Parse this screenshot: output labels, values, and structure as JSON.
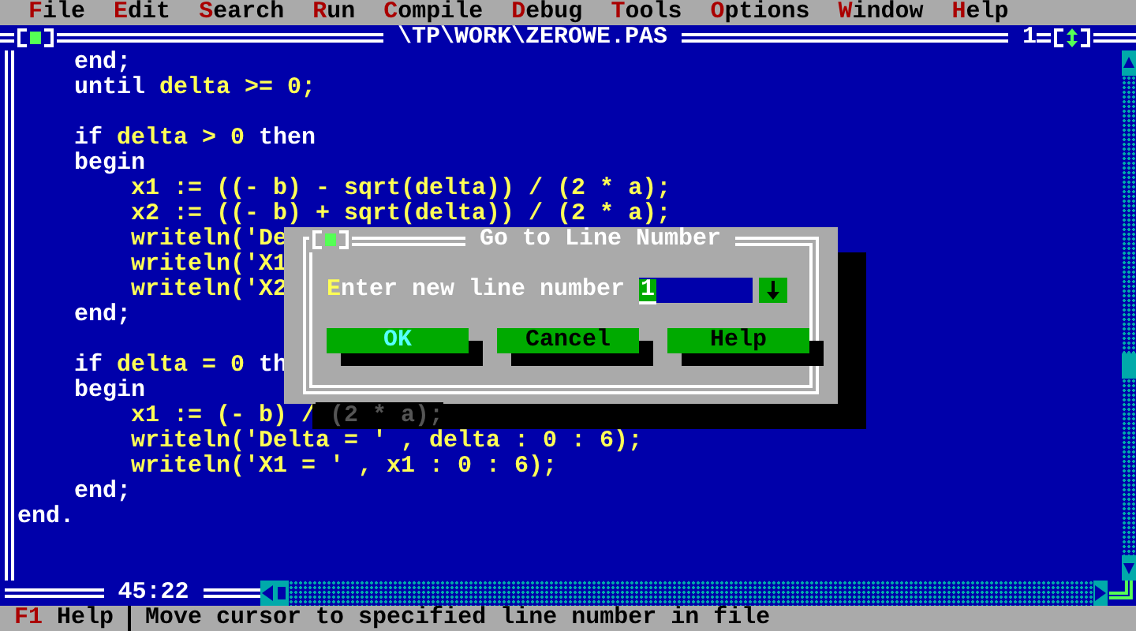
{
  "menu": [
    {
      "label": "File"
    },
    {
      "label": "Edit"
    },
    {
      "label": "Search"
    },
    {
      "label": "Run"
    },
    {
      "label": "Compile"
    },
    {
      "label": "Debug"
    },
    {
      "label": "Tools"
    },
    {
      "label": "Options"
    },
    {
      "label": "Window"
    },
    {
      "label": "Help"
    }
  ],
  "editor": {
    "title": "\\TP\\WORK\\ZEROWE.PAS",
    "window_number": "1",
    "cursor_position": "45:22",
    "lines": [
      {
        "kind": "code",
        "tokens": [
          {
            "kind": "keyword",
            "text": "    end;"
          }
        ]
      },
      {
        "kind": "code",
        "tokens": [
          {
            "kind": "keyword",
            "text": "    until"
          },
          {
            "kind": "text",
            "text": " delta >= 0;"
          }
        ]
      },
      {
        "kind": "blank"
      },
      {
        "kind": "code",
        "tokens": [
          {
            "kind": "keyword",
            "text": "    if"
          },
          {
            "kind": "text",
            "text": " delta > 0 "
          },
          {
            "kind": "keyword",
            "text": "then"
          }
        ]
      },
      {
        "kind": "code",
        "tokens": [
          {
            "kind": "keyword",
            "text": "    begin"
          }
        ]
      },
      {
        "kind": "code",
        "tokens": [
          {
            "kind": "text",
            "text": "        x1 := ((- b) - sqrt(delta)) / (2 * a);"
          }
        ]
      },
      {
        "kind": "code",
        "tokens": [
          {
            "kind": "text",
            "text": "        x2 := ((- b) + sqrt(delta)) / (2 * a);"
          }
        ]
      },
      {
        "kind": "code",
        "tokens": [
          {
            "kind": "text",
            "text": "        writeln('De"
          }
        ]
      },
      {
        "kind": "code",
        "tokens": [
          {
            "kind": "text",
            "text": "        writeln('X1"
          }
        ]
      },
      {
        "kind": "code",
        "tokens": [
          {
            "kind": "text",
            "text": "        writeln('X2"
          }
        ]
      },
      {
        "kind": "code",
        "tokens": [
          {
            "kind": "keyword",
            "text": "    end;"
          }
        ]
      },
      {
        "kind": "blank"
      },
      {
        "kind": "code",
        "tokens": [
          {
            "kind": "keyword",
            "text": "    if"
          },
          {
            "kind": "text",
            "text": " delta = 0 "
          },
          {
            "kind": "keyword",
            "text": "th"
          }
        ]
      },
      {
        "kind": "code",
        "tokens": [
          {
            "kind": "keyword",
            "text": "    begin"
          }
        ]
      },
      {
        "kind": "code",
        "tokens": [
          {
            "kind": "text",
            "text": "        x1 := (- b) /"
          }
        ],
        "shadowed_text": " (2 * a);"
      },
      {
        "kind": "code",
        "tokens": [
          {
            "kind": "text",
            "text": "        writeln('Delta = ' , delta : 0 : 6);"
          }
        ]
      },
      {
        "kind": "code",
        "tokens": [
          {
            "kind": "text",
            "text": "        writeln('X1 = ' , x1 : 0 : 6);"
          }
        ]
      },
      {
        "kind": "code",
        "tokens": [
          {
            "kind": "keyword",
            "text": "    end;"
          }
        ]
      },
      {
        "kind": "code",
        "tokens": [
          {
            "kind": "keyword",
            "text": "end."
          }
        ]
      },
      {
        "kind": "blank"
      },
      {
        "kind": "blank"
      }
    ]
  },
  "dialog": {
    "title": "Go to Line Number",
    "label": "Enter new line number",
    "field": {
      "value": "1",
      "selected": true
    },
    "buttons": [
      {
        "label": "OK",
        "default": true
      },
      {
        "label": "Cancel",
        "default": false
      },
      {
        "label": "Help",
        "default": false
      }
    ]
  },
  "status_bar": {
    "key": "F1",
    "key_label": "Help",
    "hint": "Move cursor to specified line number in file"
  }
}
